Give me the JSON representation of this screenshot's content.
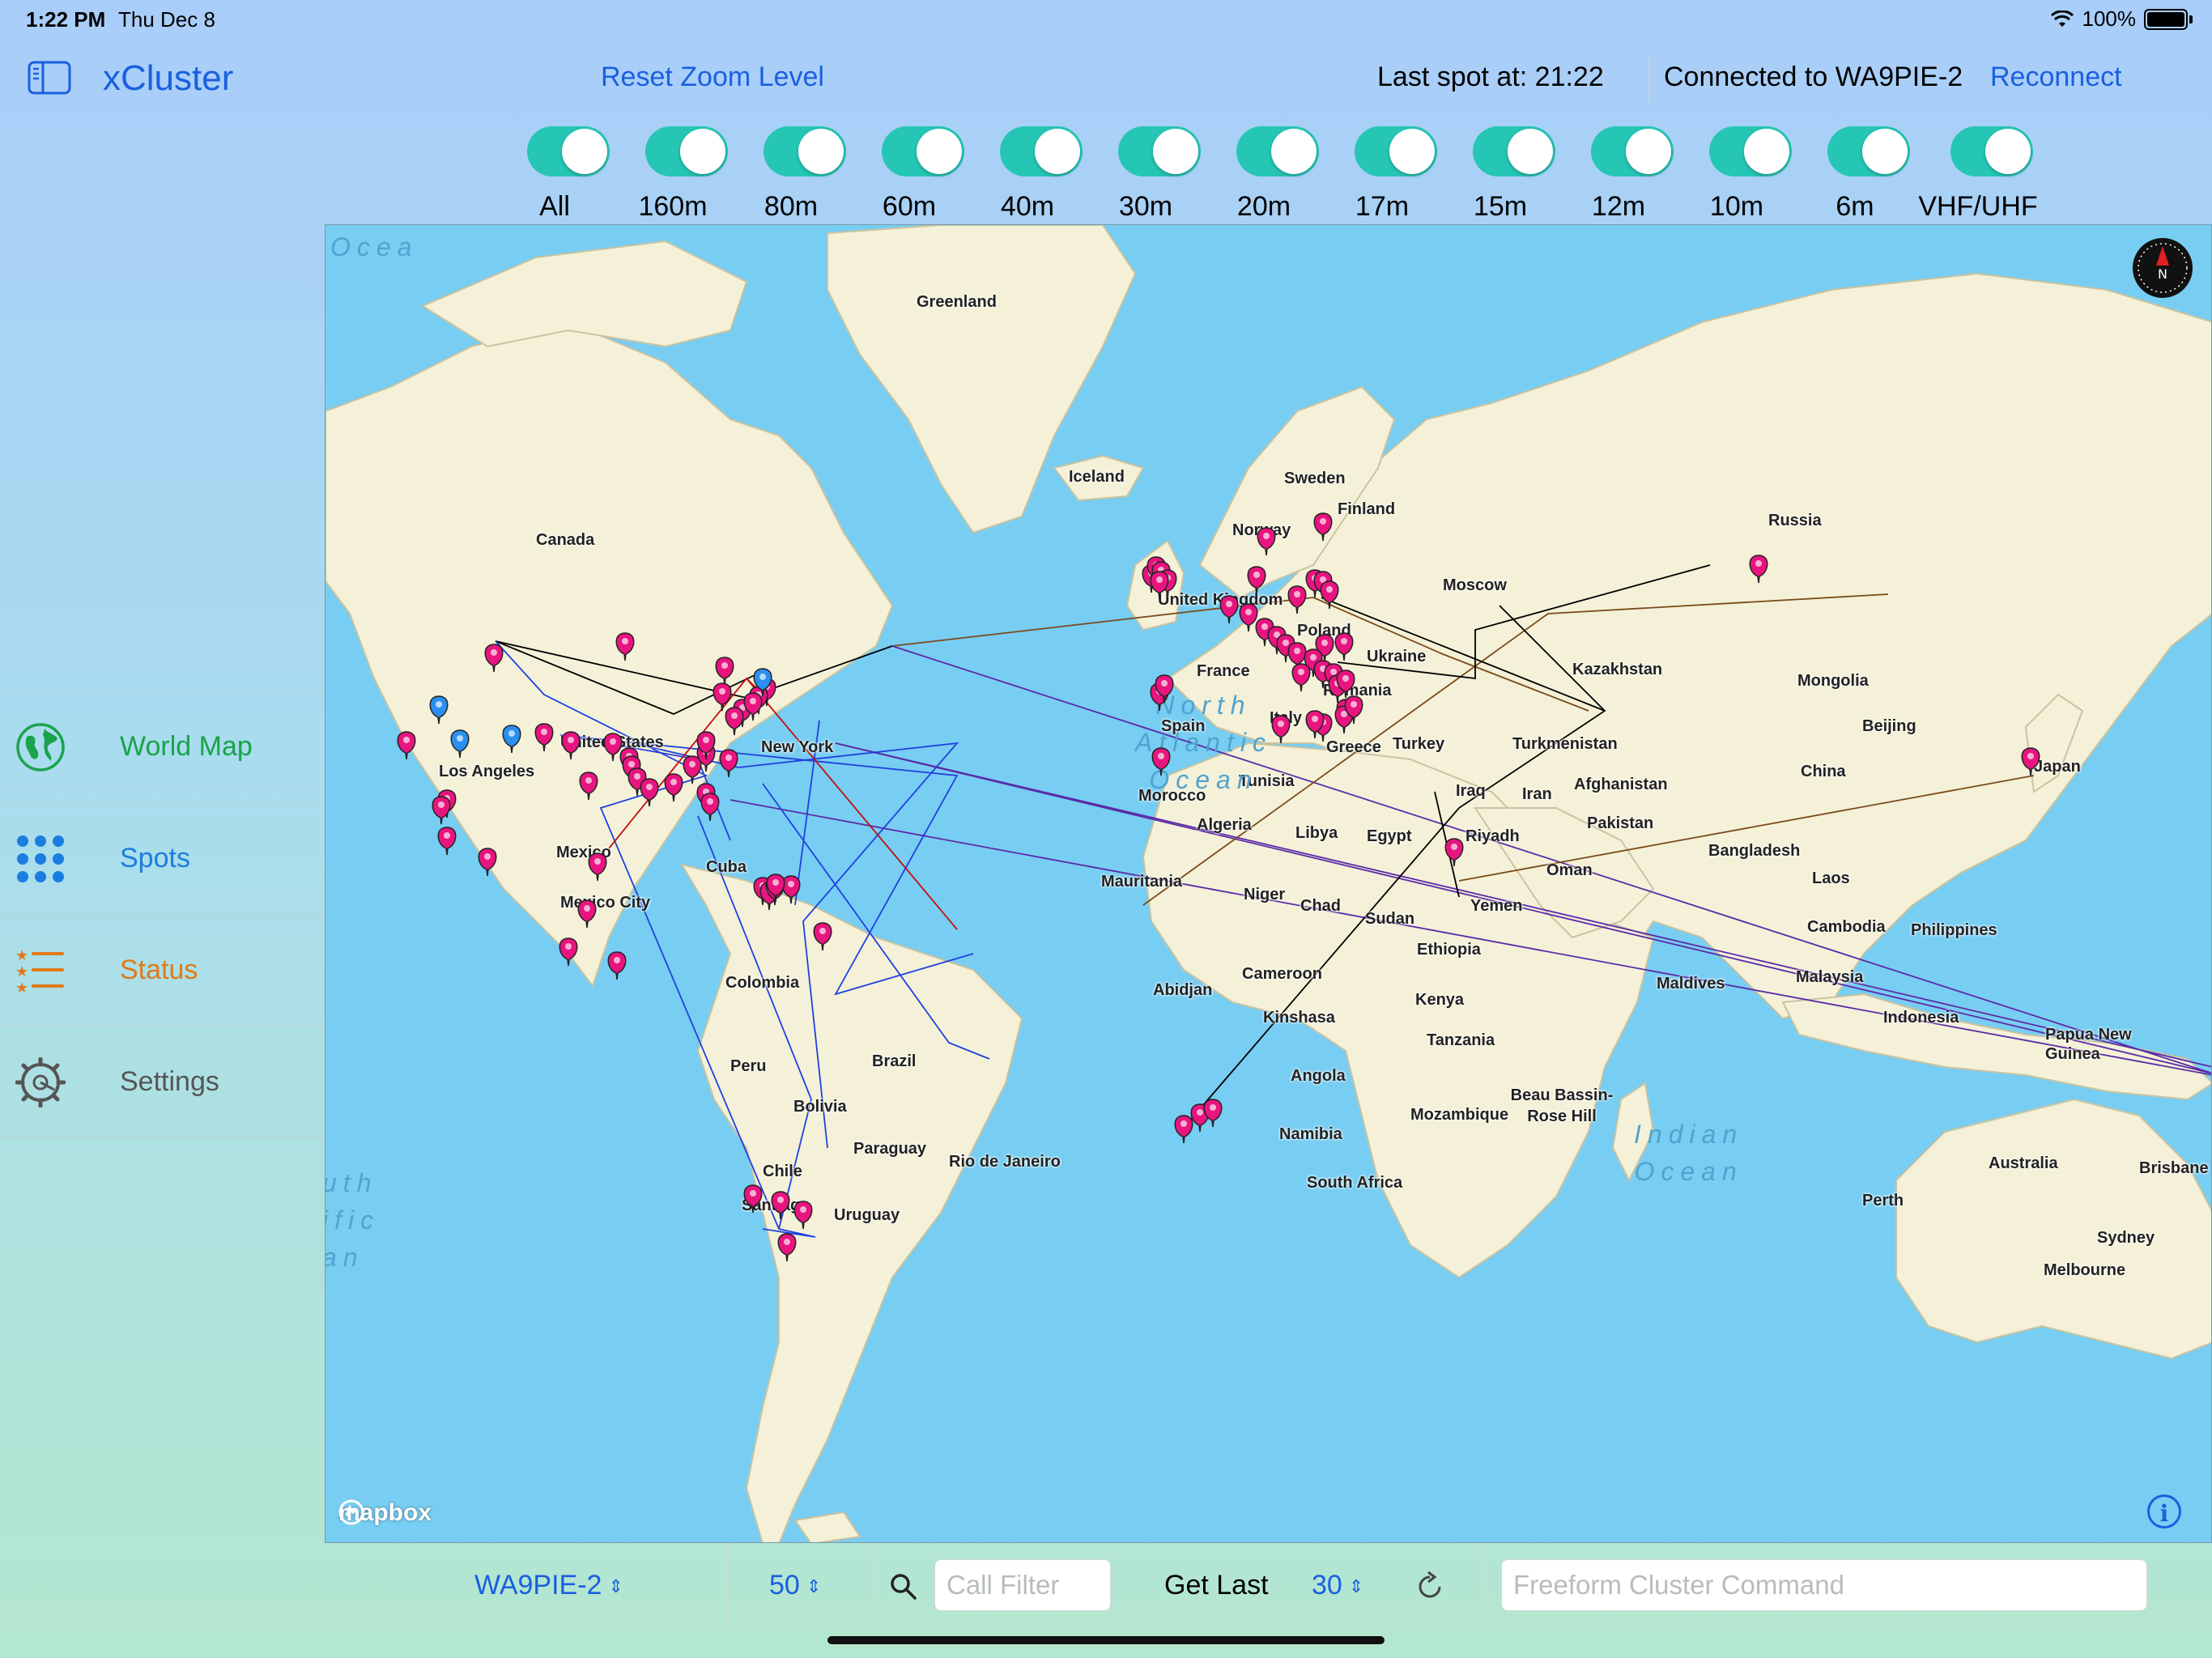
{
  "status_bar": {
    "time": "1:22 PM",
    "date": "Thu Dec 8",
    "battery": "100%"
  },
  "sidebar": {
    "app_title": "xCluster",
    "items": [
      {
        "label": "World Map",
        "color": "#1aa34a",
        "icon": "globe-icon"
      },
      {
        "label": "Spots",
        "color": "#1a7ee0",
        "icon": "grid-dots-icon"
      },
      {
        "label": "Status",
        "color": "#e07a1a",
        "icon": "list-stars-icon"
      },
      {
        "label": "Settings",
        "color": "#555555",
        "icon": "gear-icon"
      }
    ]
  },
  "header": {
    "reset_zoom": "Reset Zoom Level",
    "last_spot": "Last spot at: 21:22",
    "connected": "Connected to WA9PIE-2",
    "reconnect": "Reconnect"
  },
  "bands": [
    "All",
    "160m",
    "80m",
    "60m",
    "40m",
    "30m",
    "20m",
    "17m",
    "15m",
    "12m",
    "10m",
    "6m",
    "VHF/UHF"
  ],
  "map": {
    "labels": {
      "greenland": "Greenland",
      "iceland": "Iceland",
      "canada": "Canada",
      "united_states": "United States",
      "los_angeles": "Los Angeles",
      "new_york": "New York",
      "mexico": "Mexico",
      "mexico_city": "Mexico City",
      "cuba": "Cuba",
      "colombia": "Colombia",
      "peru": "Peru",
      "brazil": "Brazil",
      "bolivia": "Bolivia",
      "paraguay": "Paraguay",
      "chile": "Chile",
      "santiago": "Santiago",
      "uruguay": "Uruguay",
      "rio": "Rio de Janeiro",
      "sweden": "Sweden",
      "finland": "Finland",
      "norway": "Norway",
      "uk": "United Kingdom",
      "poland": "Poland",
      "ukraine": "Ukraine",
      "france": "France",
      "spain": "Spain",
      "italy": "Italy",
      "romania": "Romania",
      "greece": "Greece",
      "turkey": "Turkey",
      "moscow": "Moscow",
      "russia": "Russia",
      "kazakhstan": "Kazakhstan",
      "mongolia": "Mongolia",
      "turkmenistan": "Turkmenistan",
      "beijing": "Beijing",
      "japan": "Japan",
      "china": "China",
      "iraq": "Iraq",
      "iran": "Iran",
      "afghanistan": "Afghanistan",
      "pakistan": "Pakistan",
      "morocco": "Morocco",
      "tunisia": "Tunisia",
      "algeria": "Algeria",
      "libya": "Libya",
      "egypt": "Egypt",
      "riyadh": "Riyadh",
      "oman": "Oman",
      "yemen": "Yemen",
      "bangladesh": "Bangladesh",
      "mauritania": "Mauritania",
      "niger": "Niger",
      "chad": "Chad",
      "sudan": "Sudan",
      "ethiopia": "Ethiopia",
      "laos": "Laos",
      "cambodia": "Cambodia",
      "philippines": "Philippines",
      "cameroon": "Cameroon",
      "abidjan": "Abidjan",
      "kenya": "Kenya",
      "maldives": "Maldives",
      "malaysia": "Malaysia",
      "kinshasa": "Kinshasa",
      "tanzania": "Tanzania",
      "indonesia": "Indonesia",
      "png": "Papua New Guinea",
      "angola": "Angola",
      "mozambique": "Mozambique",
      "beau_bassin": "Beau Bassin-Rose Hill",
      "namibia": "Namibia",
      "south_africa": "South Africa",
      "australia": "Australia",
      "brisbane": "Brisbane",
      "perth": "Perth",
      "sydney": "Sydney",
      "melbourne": "Melbourne"
    },
    "oceans": {
      "north_atlantic": "North\nAtlantic\nOcean",
      "indian": "Indian\nOcean",
      "south_pacific": "uth\nific\nan",
      "ocean_nw": "Ocea"
    },
    "attribution": "mapbox"
  },
  "toolbar": {
    "cluster": "WA9PIE-2",
    "max_spots": "50",
    "call_filter_placeholder": "Call Filter",
    "get_last_label": "Get Last",
    "get_last_value": "30",
    "freeform_placeholder": "Freeform Cluster Command"
  },
  "colors": {
    "accent": "#1a5fe0",
    "toggle_on": "#26c6b4",
    "pin": "#e8147f",
    "pin_blue": "#2a8ff0",
    "land": "#f4f1d8",
    "water": "#78cdf2"
  }
}
